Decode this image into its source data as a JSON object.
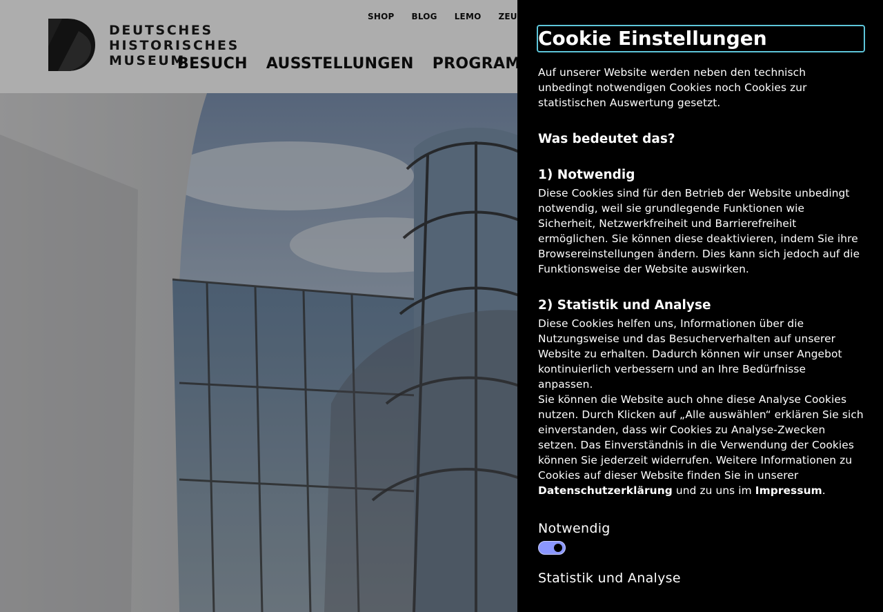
{
  "logo": {
    "lines": [
      "DEUTSCHES",
      "HISTORISCHES",
      "MUSEUM"
    ]
  },
  "top_nav": [
    "SHOP",
    "BLOG",
    "LEMO",
    "ZEUG"
  ],
  "main_nav": [
    "BESUCH",
    "AUSSTELLUNGEN",
    "PROGRAMM"
  ],
  "cookie_panel": {
    "title": "Cookie Einstellungen",
    "intro": "Auf unserer Website werden neben den technisch unbedingt notwendigen Cookies noch Cookies zur statistischen Auswertung gesetzt.",
    "question": "Was bedeutet das?",
    "section1_title": "1) Notwendig",
    "section1_text": "Diese Cookies sind für den Betrieb der Website unbedingt notwendig, weil sie grundlegende Funktionen wie Sicherheit, Netzwerkfreiheit und Barrierefreiheit ermöglichen. Sie können diese deaktivieren, indem Sie ihre Browsereinstellungen ändern. Dies kann sich jedoch auf die Funktionsweise der Website auswirken.",
    "section2_title": "2) Statistik und Analyse",
    "section2_text": "Diese Cookies helfen uns, Informationen über die Nutzungsweise und das Besucherverhalten auf unserer Website zu erhalten. Dadurch können wir unser Angebot kontinuierlich verbessern und an Ihre Bedürfnisse anpassen.",
    "section2_text2_before": "Sie können die Website auch ohne diese Analyse Cookies nutzen. Durch Klicken auf „Alle auswählen“ erklären Sie sich einverstanden, dass wir Cookies zu Analyse-Zwecken setzen. Das Einverständnis in die Verwendung der Cookies können Sie jederzeit widerrufen. Weitere Informationen zu Cookies auf dieser Website finden Sie in unserer ",
    "privacy_link": "Datenschutzerklärung",
    "section2_text2_middle": " und zu uns im ",
    "imprint_link": "Impressum",
    "section2_text2_end": ".",
    "toggle1_label": "Notwendig",
    "toggle1_state": "on",
    "toggle2_label": "Statistik und Analyse"
  },
  "colors": {
    "panel_bg": "#000000",
    "focus_outline": "#5ec6da",
    "toggle_on": "#8b97ff"
  }
}
